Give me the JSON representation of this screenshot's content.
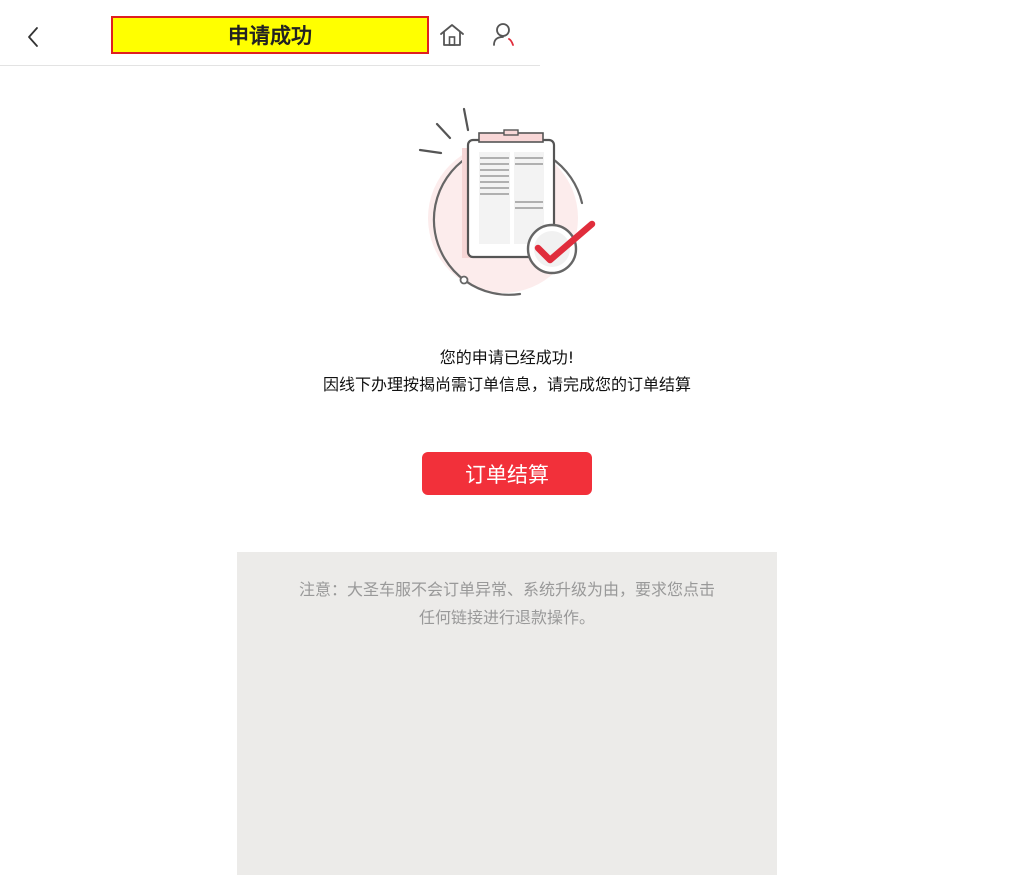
{
  "header": {
    "title": "申请成功",
    "back_icon": "chevron-left-icon",
    "home_icon": "home-icon",
    "user_icon": "user-icon"
  },
  "illustration": {
    "icon": "clipboard-success-icon",
    "accent_color": "#e02d3c"
  },
  "message": {
    "line1": "您的申请已经成功!",
    "line2": "因线下办理按揭尚需订单信息，请完成您的订单结算"
  },
  "action": {
    "pay_label": "订单结算",
    "color": "#f2303a"
  },
  "notice": {
    "line1": "注意：大圣车服不会订单异常、系统升级为由，要求您点击",
    "line2": "任何链接进行退款操作。"
  }
}
